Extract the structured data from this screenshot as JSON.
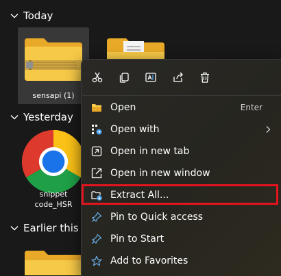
{
  "groups": {
    "today": "Today",
    "yesterday": "Yesterday",
    "earlier": "Earlier this w"
  },
  "files": [
    {
      "name": "sensapi (1)",
      "icon": "zip-folder-icon"
    },
    {
      "name": "",
      "icon": "folder-document-icon"
    },
    {
      "name": "snippet\ncode_HSR",
      "icon": "chrome-icon"
    }
  ],
  "context_menu": {
    "toolbar": [
      {
        "name": "cut-icon",
        "label": "Cut"
      },
      {
        "name": "copy-icon",
        "label": "Copy"
      },
      {
        "name": "rename-icon",
        "label": "Rename"
      },
      {
        "name": "share-icon",
        "label": "Share"
      },
      {
        "name": "delete-icon",
        "label": "Delete"
      }
    ],
    "items": [
      {
        "label": "Open",
        "shortcut": "Enter",
        "icon": "folder-open-icon"
      },
      {
        "label": "Open with",
        "submenu": true,
        "icon": "open-with-icon"
      },
      {
        "label": "Open in new tab",
        "icon": "new-tab-icon"
      },
      {
        "label": "Open in new window",
        "icon": "new-window-icon"
      },
      {
        "label": "Extract All...",
        "icon": "extract-icon",
        "highlighted": true
      },
      {
        "label": "Pin to Quick access",
        "icon": "pin-icon"
      },
      {
        "label": "Pin to Start",
        "icon": "pin-icon"
      },
      {
        "label": "Add to Favorites",
        "icon": "star-icon"
      }
    ]
  },
  "colors": {
    "background": "#191919",
    "menu": "#2a2926",
    "highlight": "#e3141e",
    "accent": "#4aa0e6",
    "folder": "#f7c948"
  }
}
